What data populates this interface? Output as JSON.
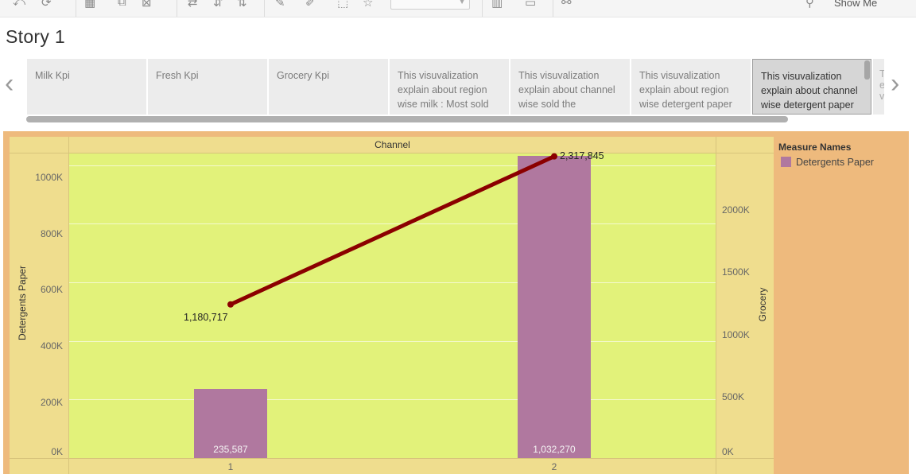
{
  "toolbar": {
    "show_me_label": "Show Me"
  },
  "story": {
    "title": "Story 1",
    "points": [
      {
        "text": "Milk Kpi"
      },
      {
        "text": "Fresh Kpi"
      },
      {
        "text": "Grocery Kpi"
      },
      {
        "text": "This visuvalization explain about  region wise milk : Most sold"
      },
      {
        "text": "This visuvalization explain about  channel wise sold the"
      },
      {
        "text": "This visuvalization explain about  region wise  detergent paper"
      },
      {
        "text": "This visuvalization explain about  channel wise detergent paper"
      }
    ],
    "partial_point_text": "Th e v"
  },
  "colors": {
    "bar": "#b0789f",
    "line": "#8b0000",
    "plot_bg": "#e2f27a",
    "dashboard_bg": "#eeba7d"
  },
  "legend": {
    "title": "Measure Names",
    "items": [
      "Detergents Paper"
    ]
  },
  "chart_data": {
    "type": "bar",
    "title": "",
    "column_header": "Channel",
    "categories": [
      "1",
      "2"
    ],
    "xlabel": "",
    "ylabel": "Detergents Paper",
    "y2label": "Grocery",
    "ylim": [
      0,
      1040000
    ],
    "y2lim": [
      0,
      2340000
    ],
    "yticks": [
      "0K",
      "200K",
      "400K",
      "600K",
      "800K",
      "1000K"
    ],
    "y2ticks": [
      "0K",
      "500K",
      "1000K",
      "1500K",
      "2000K"
    ],
    "grid": true,
    "legend_position": "right",
    "series": [
      {
        "name": "Detergents Paper",
        "type": "bar",
        "axis": "left",
        "values": [
          235587
        ],
        "labels": [
          "235,587",
          "1,032,270"
        ],
        "values_all": [
          235587,
          1032270
        ]
      },
      {
        "name": "Grocery",
        "type": "line",
        "axis": "right",
        "values": [
          1180717,
          2317845
        ],
        "labels": [
          "1,180,717",
          "2,317,845"
        ]
      }
    ]
  }
}
